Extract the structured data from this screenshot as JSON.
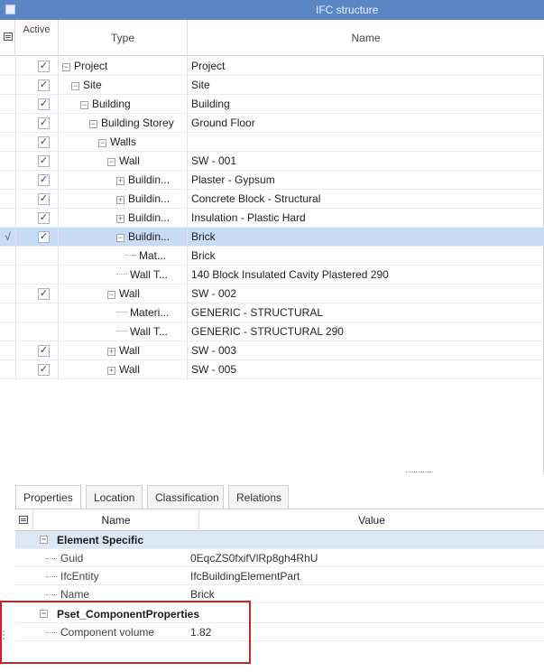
{
  "panel": {
    "title": "IFC structure"
  },
  "tree": {
    "headers": {
      "active": "Active",
      "type": "Type",
      "name": "Name"
    },
    "rows": [
      {
        "level": 0,
        "exp": "−",
        "active": true,
        "type": "Project",
        "name": "Project"
      },
      {
        "level": 1,
        "exp": "−",
        "active": true,
        "type": "Site",
        "name": "Site"
      },
      {
        "level": 2,
        "exp": "−",
        "active": true,
        "type": "Building",
        "name": "Building"
      },
      {
        "level": 3,
        "exp": "−",
        "active": true,
        "type": "Building Storey",
        "name": "Ground Floor"
      },
      {
        "level": 4,
        "exp": "−",
        "active": true,
        "type": "Walls",
        "name": ""
      },
      {
        "level": 5,
        "exp": "−",
        "active": true,
        "type": "Wall",
        "name": "SW - 001"
      },
      {
        "level": 6,
        "exp": "+",
        "active": true,
        "type": "Buildin...",
        "name": "Plaster - Gypsum"
      },
      {
        "level": 6,
        "exp": "+",
        "active": true,
        "type": "Buildin...",
        "name": "Concrete Block - Structural"
      },
      {
        "level": 6,
        "exp": "+",
        "active": true,
        "type": "Buildin...",
        "name": "Insulation - Plastic Hard"
      },
      {
        "level": 6,
        "exp": "−",
        "active": true,
        "type": "Buildin...",
        "name": "Brick",
        "selected": true,
        "mark": "√"
      },
      {
        "level": 7,
        "exp": "",
        "active": null,
        "type": "Mat...",
        "name": "Brick"
      },
      {
        "level": 6,
        "exp": "",
        "active": null,
        "type": "Wall T...",
        "name": "140 Block Insulated Cavity Plastered 290"
      },
      {
        "level": 5,
        "exp": "−",
        "active": true,
        "type": "Wall",
        "name": "SW - 002"
      },
      {
        "level": 6,
        "exp": "",
        "active": null,
        "type": "Materi...",
        "name": "GENERIC - STRUCTURAL"
      },
      {
        "level": 6,
        "exp": "",
        "active": null,
        "type": "Wall T...",
        "name": "GENERIC - STRUCTURAL 290"
      },
      {
        "level": 5,
        "exp": "+",
        "active": true,
        "type": "Wall",
        "name": "SW - 003"
      },
      {
        "level": 5,
        "exp": "+",
        "active": true,
        "type": "Wall",
        "name": "SW - 005"
      }
    ]
  },
  "tabs": [
    "Properties",
    "Location",
    "Classification",
    "Relations"
  ],
  "properties": {
    "headers": {
      "name": "Name",
      "value": "Value"
    },
    "groups": [
      {
        "name": "Element Specific",
        "items": [
          {
            "name": "Guid",
            "value": "0EqcZS0fxifVlRp8gh4RhU"
          },
          {
            "name": "IfcEntity",
            "value": "IfcBuildingElementPart"
          },
          {
            "name": "Name",
            "value": "Brick"
          }
        ]
      },
      {
        "name": "Pset_ComponentProperties",
        "items": [
          {
            "name": "Component volume",
            "value": "1.82"
          }
        ]
      }
    ]
  },
  "colors": {
    "titlebar": "#5b86c5",
    "selected_row": "#c7dcf4",
    "group_row": "#dce7f5",
    "highlight_box": "#c1272d"
  }
}
